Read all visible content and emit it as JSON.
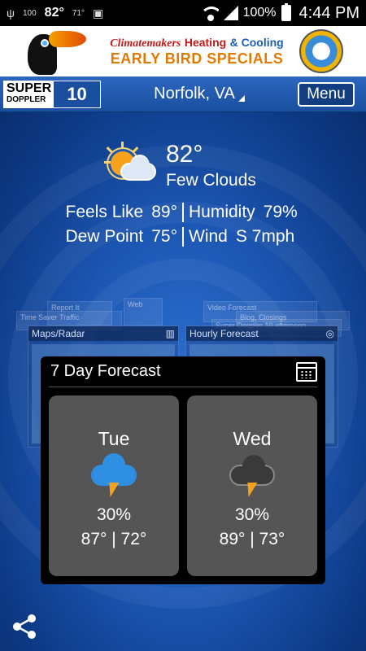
{
  "status_bar": {
    "usb": "usb-icon",
    "battery_pct_small": "100",
    "temp": "82°",
    "weather_small": "71°",
    "battery_text": "100%",
    "time": "4:44 PM"
  },
  "ad": {
    "brand": "Climatemakers",
    "service_a": "Heating",
    "service_b": "& Cooling",
    "tagline": "EARLY BIRD SPECIALS"
  },
  "header": {
    "logo_line1": "SUPER",
    "logo_line2": "DOPPLER",
    "logo_number": "10",
    "location": "Norfolk, VA",
    "menu_label": "Menu"
  },
  "current": {
    "temp": "82°",
    "condition": "Few Clouds",
    "feels_like_label": "Feels Like",
    "feels_like_value": "89°",
    "humidity_label": "Humidity",
    "humidity_value": "79%",
    "dew_point_label": "Dew Point",
    "dew_point_value": "75°",
    "wind_label": "Wind",
    "wind_value": "S 7mph"
  },
  "ghost_tiles": {
    "report_it": "Report It",
    "web": "Web",
    "time_saver": "Time Saver Traffic",
    "video_forecast": "Video Forecast",
    "blog": "Blog, Closings",
    "sd_afternoon": "Super Doppler 10 afternoon",
    "maps_radar": "Maps/Radar",
    "hourly_forecast": "Hourly Forecast"
  },
  "forecast": {
    "title": "7 Day Forecast",
    "days": [
      {
        "name": "Tue",
        "pop": "30%",
        "hilo": "87° | 72°"
      },
      {
        "name": "Wed",
        "pop": "30%",
        "hilo": "89° | 73°"
      }
    ]
  },
  "colors": {
    "accent": "#1c56b3",
    "card_bg": "#000000",
    "day_card_bg": "#555555",
    "sun": "#f7a21c"
  }
}
